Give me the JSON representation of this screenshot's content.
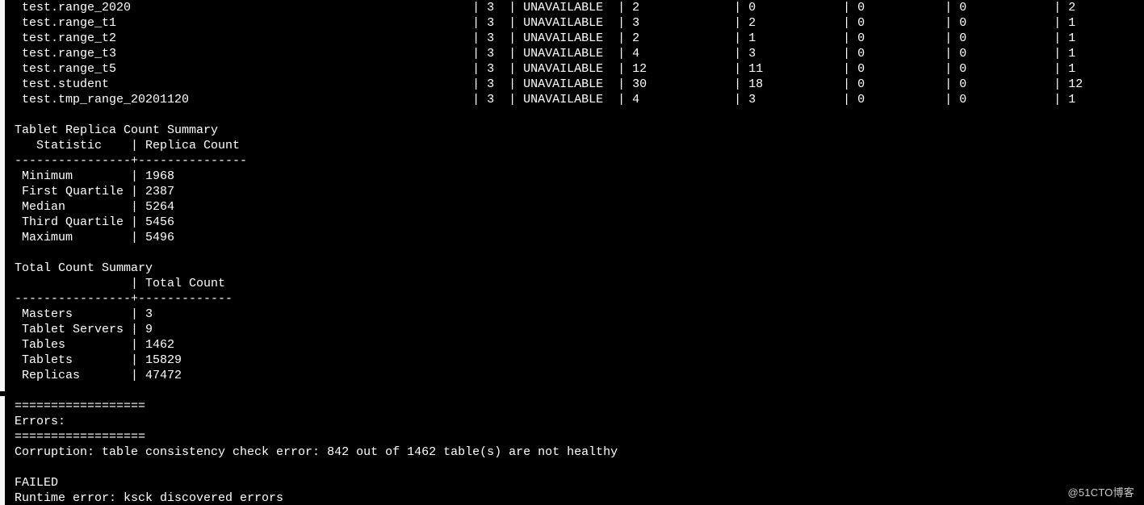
{
  "tables": [
    {
      "name": "test.range_2020",
      "rf": "3",
      "status": "UNAVAILABLE",
      "c1": "2",
      "c2": "0",
      "c3": "0",
      "c4": "0",
      "c5": "2"
    },
    {
      "name": "test.range_t1",
      "rf": "3",
      "status": "UNAVAILABLE",
      "c1": "3",
      "c2": "2",
      "c3": "0",
      "c4": "0",
      "c5": "1"
    },
    {
      "name": "test.range_t2",
      "rf": "3",
      "status": "UNAVAILABLE",
      "c1": "2",
      "c2": "1",
      "c3": "0",
      "c4": "0",
      "c5": "1"
    },
    {
      "name": "test.range_t3",
      "rf": "3",
      "status": "UNAVAILABLE",
      "c1": "4",
      "c2": "3",
      "c3": "0",
      "c4": "0",
      "c5": "1"
    },
    {
      "name": "test.range_t5",
      "rf": "3",
      "status": "UNAVAILABLE",
      "c1": "12",
      "c2": "11",
      "c3": "0",
      "c4": "0",
      "c5": "1"
    },
    {
      "name": "test.student",
      "rf": "3",
      "status": "UNAVAILABLE",
      "c1": "30",
      "c2": "18",
      "c3": "0",
      "c4": "0",
      "c5": "12"
    },
    {
      "name": "test.tmp_range_20201120",
      "rf": "3",
      "status": "UNAVAILABLE",
      "c1": "4",
      "c2": "3",
      "c3": "0",
      "c4": "0",
      "c5": "1"
    }
  ],
  "replica_summary": {
    "title": "Tablet Replica Count Summary",
    "header_stat": "Statistic",
    "header_count": "Replica Count",
    "rows": [
      {
        "stat": "Minimum",
        "count": "1968"
      },
      {
        "stat": "First Quartile",
        "count": "2387"
      },
      {
        "stat": "Median",
        "count": "5264"
      },
      {
        "stat": "Third Quartile",
        "count": "5456"
      },
      {
        "stat": "Maximum",
        "count": "5496"
      }
    ]
  },
  "total_summary": {
    "title": "Total Count Summary",
    "header_count": "Total Count",
    "rows": [
      {
        "label": "Masters",
        "count": "3"
      },
      {
        "label": "Tablet Servers",
        "count": "9"
      },
      {
        "label": "Tables",
        "count": "1462"
      },
      {
        "label": "Tablets",
        "count": "15829"
      },
      {
        "label": "Replicas",
        "count": "47472"
      }
    ]
  },
  "errors": {
    "header": "Errors:",
    "divider": "==================",
    "corruption": "Corruption: table consistency check error: 842 out of 1462 table(s) are not healthy",
    "failed": "FAILED",
    "runtime": "Runtime error: ksck discovered errors"
  },
  "watermark": "@51CTO博客"
}
